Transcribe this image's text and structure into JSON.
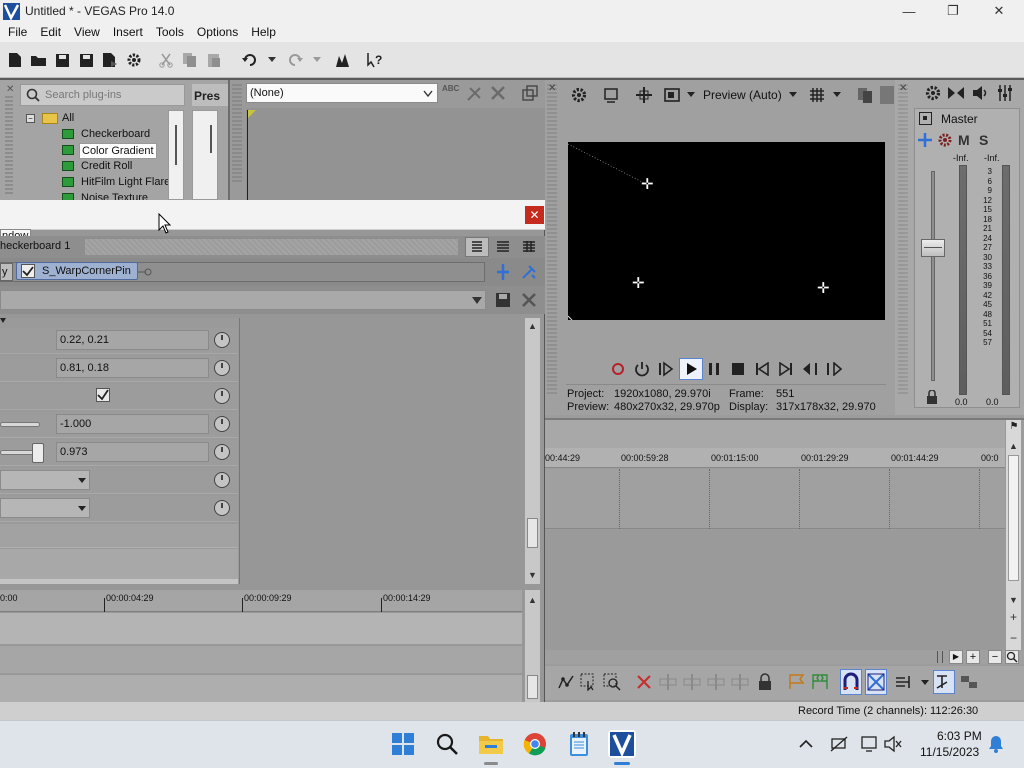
{
  "window": {
    "title": "Untitled * - VEGAS Pro 14.0",
    "minimize_glyph": "—",
    "maximize_glyph": "❐",
    "close_glyph": "✕"
  },
  "menu": [
    "File",
    "Edit",
    "View",
    "Insert",
    "Tools",
    "Options",
    "Help"
  ],
  "toolbar_icons": [
    "new-project-icon",
    "open-icon",
    "save-icon",
    "save-as-icon",
    "render-as-icon",
    "properties-gear-icon",
    "cut-icon",
    "copy-icon",
    "paste-icon",
    "undo-icon",
    "undo-history-icon",
    "redo-icon",
    "redo-history-icon",
    "enable-snapping-icon",
    "whats-this-help-icon"
  ],
  "plugin_chooser": {
    "search_placeholder": "Search plug-ins",
    "presets_label": "Pres",
    "tree_root": "All",
    "items": [
      "Checkerboard",
      "Color Gradient",
      "Credit Roll",
      "HitFilm Light Flares",
      "Noise Texture"
    ],
    "selected_item": "Color Gradient"
  },
  "media_generator_preset": {
    "preset_value": "(None)"
  },
  "fx_dialog": {
    "close_glyph": "✕",
    "tooltip": "ndow",
    "media_name": "heckerboard 1",
    "chain_partial_label": "y",
    "chain_fx_label": "S_WarpCornerPin",
    "params": [
      {
        "value": "0.22, 0.21"
      },
      {
        "value": "0.81, 0.18"
      },
      {
        "checkbox": true
      },
      {
        "value": "-1.000"
      },
      {
        "value": "0.973"
      }
    ],
    "ruler_ticks": [
      "0:00",
      "00:00:04:29",
      "00:00:09:29",
      "00:00:14:29"
    ]
  },
  "preview": {
    "mode": "Preview (Auto)",
    "project_label": "Project:",
    "project_value": "1920x1080, 29.970i",
    "preview_label": "Preview:",
    "preview_value": "480x270x32, 29.970p",
    "frame_label": "Frame:",
    "frame_value": "551",
    "display_label": "Display:",
    "display_value": "317x178x32, 29.970"
  },
  "mixer": {
    "master_label": "Master",
    "m_label": "M",
    "s_label": "S",
    "peak_left": "-Inf.",
    "peak_right": "-Inf.",
    "scale": [
      "3",
      "6",
      "9",
      "12",
      "15",
      "18",
      "21",
      "24",
      "27",
      "30",
      "33",
      "36",
      "39",
      "42",
      "45",
      "48",
      "51",
      "54",
      "57"
    ],
    "level_left": "0.0",
    "level_right": "0.0"
  },
  "timeline": {
    "ruler_ticks": [
      "00:44:29",
      "00:00:59:28",
      "00:01:15:00",
      "00:01:29:29",
      "00:01:44:29",
      "00:0"
    ]
  },
  "status": {
    "record_time": "Record Time (2 channels): 112:26:30"
  },
  "taskbar": {
    "time": "6:03 PM",
    "date": "11/15/2023",
    "apps": [
      "start-icon",
      "search-icon",
      "file-explorer-icon",
      "chrome-icon",
      "notepad-icon",
      "vegas-pro-icon"
    ]
  },
  "colors": {
    "accent_blue": "#2f6fd6",
    "close_red": "#c42b1c",
    "fx_chain_blue": "#9fb1d1"
  }
}
